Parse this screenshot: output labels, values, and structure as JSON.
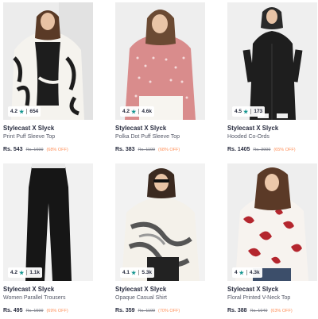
{
  "products": [
    {
      "brand": "Stylecast X Slyck",
      "name": "Print Puff Sleeve Top",
      "rating": "4.2",
      "count": "654",
      "price": "Rs. 543",
      "mrp": "Rs. 1699",
      "discount": "(68% OFF)"
    },
    {
      "brand": "Stylecast X Slyck",
      "name": "Polka Dot Puff Sleeve Top",
      "rating": "4.2",
      "count": "4.6k",
      "price": "Rs. 383",
      "mrp": "Rs. 1199",
      "discount": "(68% OFF)"
    },
    {
      "brand": "Stylecast X Slyck",
      "name": "Hooded Co-Ords",
      "rating": "4.5",
      "count": "173",
      "price": "Rs. 1405",
      "mrp": "Rs. 3999",
      "discount": "(65% OFF)"
    },
    {
      "brand": "Stylecast X Slyck",
      "name": "Women Parallel Trousers",
      "rating": "4.2",
      "count": "1.1k",
      "price": "Rs. 495",
      "mrp": "Rs. 1599",
      "discount": "(69% OFF)"
    },
    {
      "brand": "Stylecast X Slyck",
      "name": "Opaque Casual Shirt",
      "rating": "4.1",
      "count": "5.3k",
      "price": "Rs. 359",
      "mrp": "Rs. 1199",
      "discount": "(70% OFF)"
    },
    {
      "brand": "Stylecast X Slyck",
      "name": "Floral Printed V-Neck Top",
      "rating": "4",
      "count": "4.3k",
      "price": "Rs. 388",
      "mrp": "Rs. 1049",
      "discount": "(63% OFF)"
    }
  ],
  "icons": {
    "rating": "star-icon"
  },
  "colors": {
    "star": "#14958f",
    "discount": "#ff905a",
    "text": "#282c3f"
  }
}
